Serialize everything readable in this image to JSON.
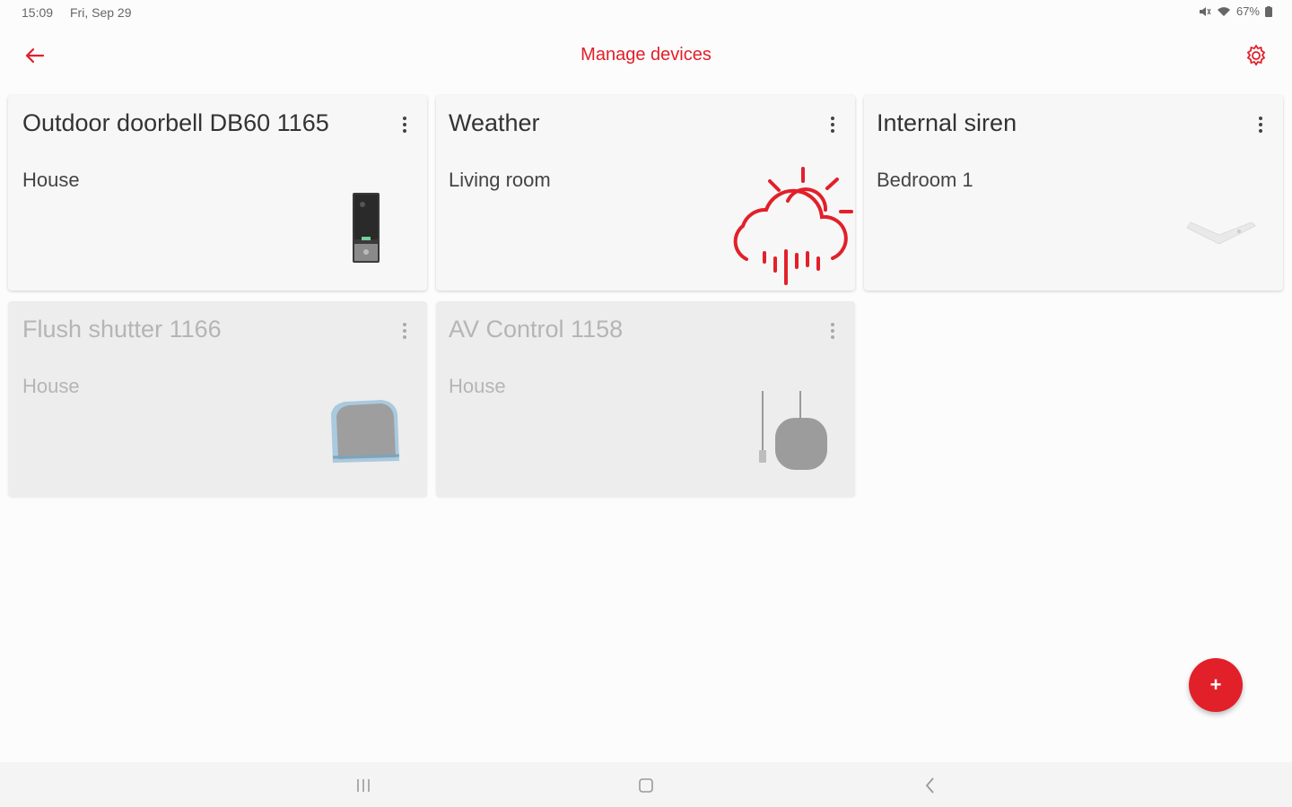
{
  "status_bar": {
    "time": "15:09",
    "date": "Fri, Sep 29",
    "battery": "67%"
  },
  "header": {
    "title": "Manage devices",
    "back_icon": "arrow-left-icon",
    "settings_icon": "gear-icon"
  },
  "devices": [
    {
      "name": "Outdoor doorbell DB60 1165",
      "room": "House",
      "state": "active",
      "image": "doorbell-icon"
    },
    {
      "name": "Weather",
      "room": "Living room",
      "state": "active",
      "image": "weather-rain-sun-icon"
    },
    {
      "name": "Internal siren",
      "room": "Bedroom 1",
      "state": "active",
      "image": "siren-icon"
    },
    {
      "name": "Flush shutter 1166",
      "room": "House",
      "state": "inactive",
      "image": "shutter-module-icon"
    },
    {
      "name": "AV Control 1158",
      "room": "House",
      "state": "inactive",
      "image": "av-control-icon"
    }
  ],
  "fab": {
    "label": "+",
    "icon": "plus-icon"
  },
  "colors": {
    "accent": "#e2202a",
    "card_background": "#f7f7f7",
    "card_inactive": "#ededed"
  }
}
